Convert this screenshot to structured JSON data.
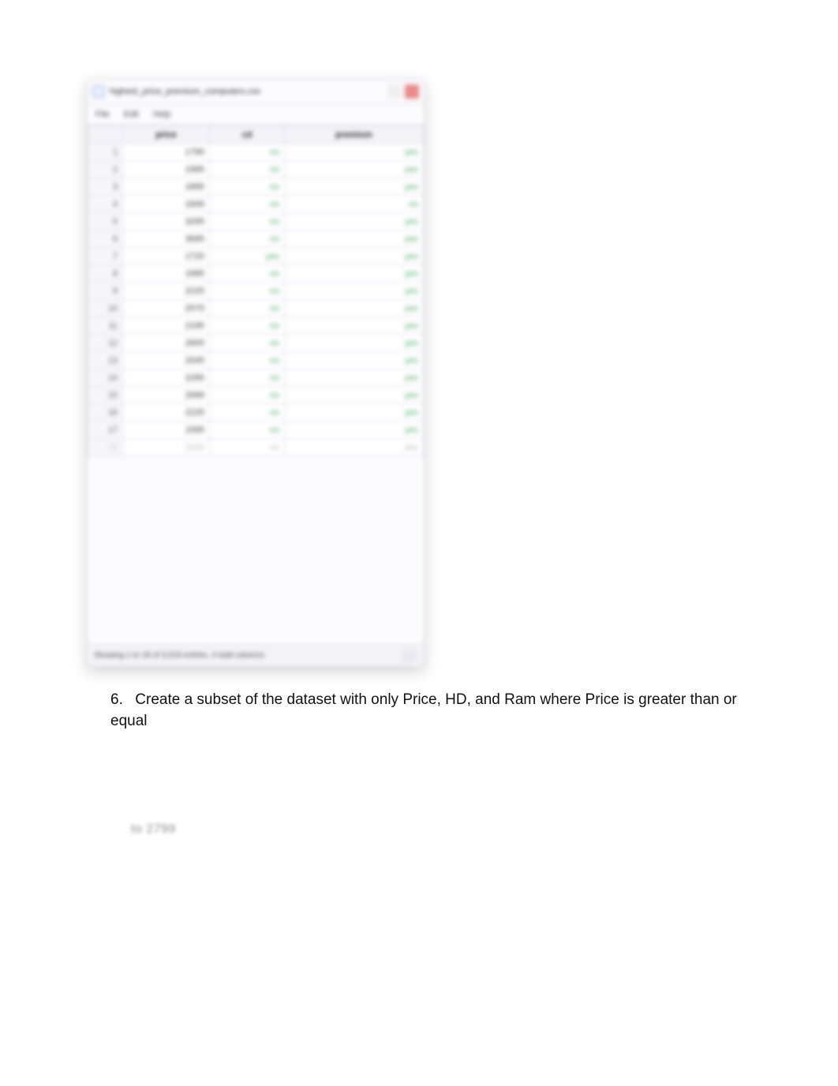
{
  "window": {
    "title": "highest_price_premium_computers.csv",
    "menu": [
      "File",
      "Edit",
      "Help"
    ],
    "cols": [
      "",
      "price",
      "cd",
      "premium"
    ],
    "rows": [
      {
        "n": "1",
        "price": "1795",
        "cd": "no",
        "premium": "yes"
      },
      {
        "n": "2",
        "price": "1995",
        "cd": "no",
        "premium": "yes"
      },
      {
        "n": "3",
        "price": "1895",
        "cd": "no",
        "premium": "yes"
      },
      {
        "n": "4",
        "price": "1849",
        "cd": "no",
        "premium": "no"
      },
      {
        "n": "5",
        "price": "3295",
        "cd": "no",
        "premium": "yes"
      },
      {
        "n": "6",
        "price": "3695",
        "cd": "no",
        "premium": "yes"
      },
      {
        "n": "7",
        "price": "1720",
        "cd": "yes",
        "premium": "yes"
      },
      {
        "n": "8",
        "price": "1995",
        "cd": "no",
        "premium": "yes"
      },
      {
        "n": "9",
        "price": "2225",
        "cd": "no",
        "premium": "yes"
      },
      {
        "n": "10",
        "price": "2575",
        "cd": "no",
        "premium": "yes"
      },
      {
        "n": "11",
        "price": "2195",
        "cd": "no",
        "premium": "yes"
      },
      {
        "n": "12",
        "price": "2605",
        "cd": "no",
        "premium": "yes"
      },
      {
        "n": "13",
        "price": "2045",
        "cd": "no",
        "premium": "yes"
      },
      {
        "n": "14",
        "price": "2295",
        "cd": "no",
        "premium": "yes"
      },
      {
        "n": "15",
        "price": "2699",
        "cd": "no",
        "premium": "yes"
      },
      {
        "n": "16",
        "price": "2225",
        "cd": "no",
        "premium": "yes"
      },
      {
        "n": "17",
        "price": "1595",
        "cd": "no",
        "premium": "yes"
      },
      {
        "n": "18",
        "price": "2325",
        "cd": "no",
        "premium": "yes"
      }
    ],
    "status": "Showing 1 to 18 of 3,519 entries, 4 total columns"
  },
  "question": {
    "number": "6.",
    "text": "Create a subset of the dataset with only Price, HD, and Ram where Price is greater than or equal"
  },
  "footer": "to 2799"
}
